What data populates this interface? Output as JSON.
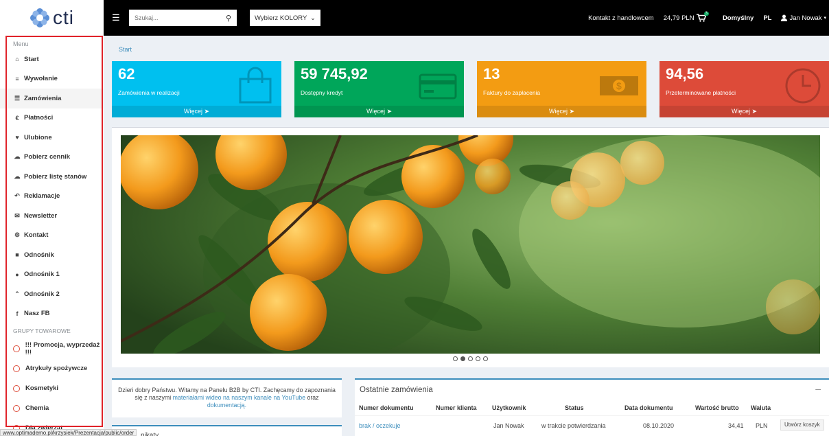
{
  "brand": {
    "logo_text": "cti"
  },
  "sidebar": {
    "menu_heading": "Menu",
    "items": [
      {
        "label": "Start",
        "icon": "home-icon",
        "glyph": "⌂"
      },
      {
        "label": "Wywołanie",
        "icon": "list-icon",
        "glyph": "≡"
      },
      {
        "label": "Zamówienia",
        "icon": "menu-icon",
        "glyph": "☰"
      },
      {
        "label": "Płatności",
        "icon": "euro-icon",
        "glyph": "€"
      },
      {
        "label": "Ulubione",
        "icon": "heart-icon",
        "glyph": "♥"
      },
      {
        "label": "Pobierz cennik",
        "icon": "cloud-download-icon",
        "glyph": "☁"
      },
      {
        "label": "Pobierz listę stanów",
        "icon": "cloud-download-icon",
        "glyph": "☁"
      },
      {
        "label": "Reklamacje",
        "icon": "reply-icon",
        "glyph": "↶"
      },
      {
        "label": "Newsletter",
        "icon": "envelope-icon",
        "glyph": "✉"
      },
      {
        "label": "Kontakt",
        "icon": "cogs-icon",
        "glyph": "⚙"
      },
      {
        "label": "Odnośnik",
        "icon": "square-icon",
        "glyph": "■"
      },
      {
        "label": "Odnośnik 1",
        "icon": "circle-icon",
        "glyph": "●"
      },
      {
        "label": "Odnośnik 2",
        "icon": "chevron-up-icon",
        "glyph": "⌃"
      },
      {
        "label": "Nasz FB",
        "icon": "facebook-icon",
        "glyph": "f"
      }
    ],
    "active_index": 2,
    "groups_heading": "GRUPY TOWAROWE",
    "groups": [
      {
        "label": "!!! Promocja, wyprzedaż !!!"
      },
      {
        "label": "Atrykuły spożywcze"
      },
      {
        "label": "Kosmetyki"
      },
      {
        "label": "Chemia"
      },
      {
        "label": "Dla zwierząt"
      }
    ]
  },
  "status_url": "www.optimademo.pl/krzysiek/Prezentacja/public/order",
  "topbar": {
    "search_placeholder": "Szukaj...",
    "color_select": "Wybierz KOLORY",
    "contact": "Kontakt z handlowcem",
    "cart_total": "24,79 PLN",
    "cart_badge": "3",
    "profile": "Domyślny",
    "language": "PL",
    "user": "Jan Nowak"
  },
  "breadcrumb": "Start",
  "info_boxes": [
    {
      "value": "62",
      "label": "Zamówienia w realizacji",
      "more": "Więcej",
      "color": "#00c0ef",
      "icon": "shopping-bag-icon"
    },
    {
      "value": "59 745,92",
      "label": "Dostępny kredyt",
      "more": "Więcej",
      "color": "#00a65a",
      "icon": "credit-card-icon"
    },
    {
      "value": "13",
      "label": "Faktury do zapłacenia",
      "more": "Więcej",
      "color": "#f39c12",
      "icon": "money-icon"
    },
    {
      "value": "94,56",
      "label": "Przeterminowane płatności",
      "more": "Więcej",
      "color": "#dd4b39",
      "icon": "clock-icon"
    }
  ],
  "slider": {
    "slide_count": 5,
    "active_slide": 1
  },
  "welcome": {
    "part1": "Dzień dobry Państwu. Witamy na Panelu B2B by CTI. Zachęcamy do zapoznania się z naszymi",
    "link1": "materiałami wideo na naszym kanale na YouTube",
    "part2": "oraz",
    "link2": "dokumentacją."
  },
  "messages_title": "nikaty",
  "orders": {
    "title": "Ostatnie zamówienia",
    "collapse": "–",
    "columns": [
      "Numer dokumentu",
      "Numer klienta",
      "Użytkownik",
      "Status",
      "Data dokumentu",
      "Wartość brutto",
      "Waluta"
    ],
    "rows": [
      {
        "doc": "brak / oczekuje",
        "client": "",
        "user": "Jan Nowak",
        "status": "w trakcie potwierdzania",
        "date": "08.10.2020",
        "value": "34,41",
        "currency": "PLN",
        "action": "Utwórz koszyk"
      }
    ]
  }
}
